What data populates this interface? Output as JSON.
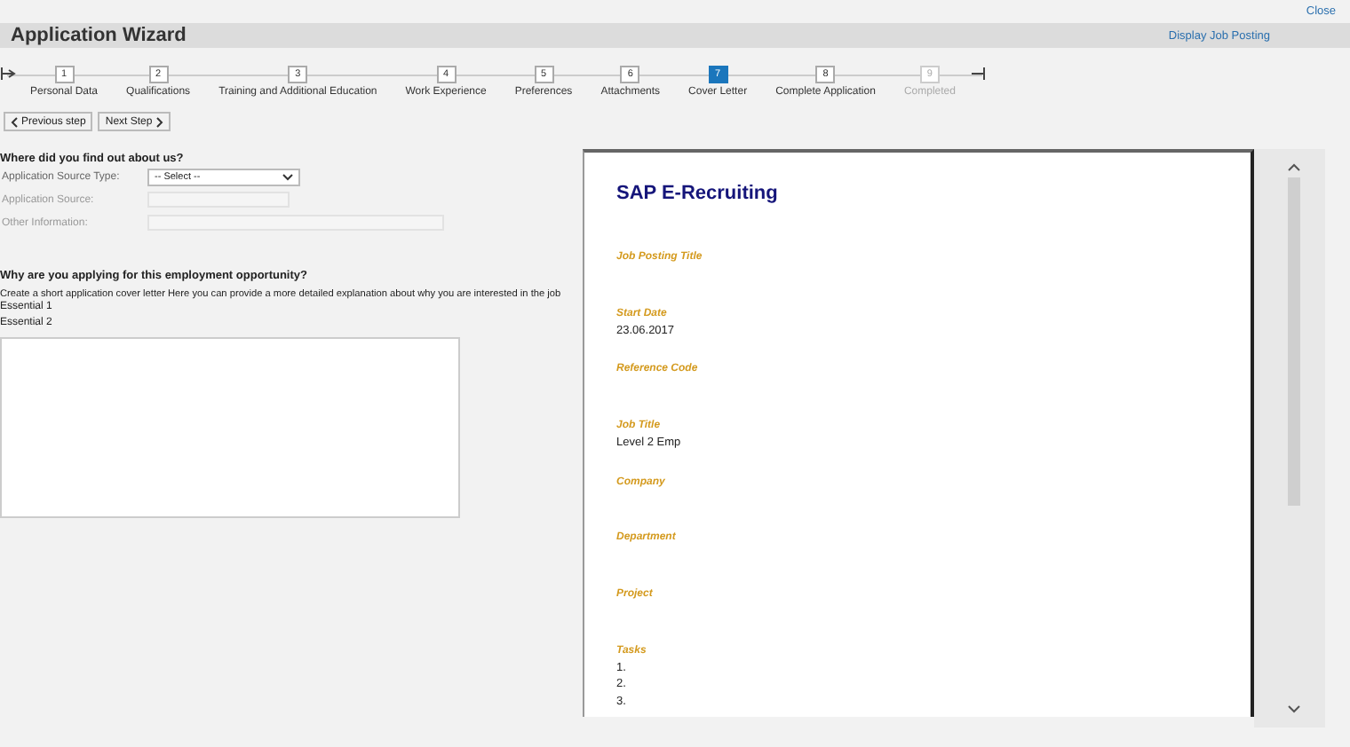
{
  "close_link": "Close",
  "header": {
    "title": "Application Wizard",
    "link": "Display Job Posting"
  },
  "steps": [
    {
      "number": "1",
      "label": "Personal Data",
      "selected": false,
      "disabled": false
    },
    {
      "number": "2",
      "label": "Qualifications",
      "selected": false,
      "disabled": false
    },
    {
      "number": "3",
      "label": "Training and Additional Education",
      "selected": false,
      "disabled": false
    },
    {
      "number": "4",
      "label": "Work Experience",
      "selected": false,
      "disabled": false
    },
    {
      "number": "5",
      "label": "Preferences",
      "selected": false,
      "disabled": false
    },
    {
      "number": "6",
      "label": "Attachments",
      "selected": false,
      "disabled": false
    },
    {
      "number": "7",
      "label": "Cover Letter",
      "selected": true,
      "disabled": false
    },
    {
      "number": "8",
      "label": "Complete Application",
      "selected": false,
      "disabled": false
    },
    {
      "number": "9",
      "label": "Completed",
      "selected": false,
      "disabled": true
    }
  ],
  "nav_buttons": [
    {
      "kind": "prev",
      "label": "Previous step"
    },
    {
      "kind": "next",
      "label": "Next Step"
    }
  ],
  "source_section": {
    "heading": "Where did you find out about us?",
    "fields": [
      {
        "kind": "select",
        "label": "Application Source Type:",
        "value": "-- Select --",
        "disabled": false
      },
      {
        "kind": "text",
        "label": "Application Source:",
        "disabled": true
      },
      {
        "kind": "wide",
        "label": "Other Information:",
        "disabled": true
      }
    ]
  },
  "cover_section": {
    "heading": "Why are you applying for this employment opportunity?",
    "instruction": "Create a short application cover letter Here you can provide a more detailed explanation about why you are interested in the job",
    "notes": [
      "Essential 1",
      "Essential 2"
    ]
  },
  "document": {
    "title": "SAP E-Recruiting",
    "sections": [
      {
        "label": "Job Posting Title"
      },
      {
        "label": "Start Date",
        "lines": [
          "23.06.2017"
        ]
      },
      {
        "label": "Reference Code"
      },
      {
        "label": "Job Title",
        "lines": [
          "Level 2 Emp"
        ]
      },
      {
        "label": "Company"
      },
      {
        "label": "Department"
      },
      {
        "label": "Project"
      },
      {
        "label": "Tasks",
        "lines": [
          "1.",
          "2.",
          "3."
        ]
      }
    ]
  }
}
